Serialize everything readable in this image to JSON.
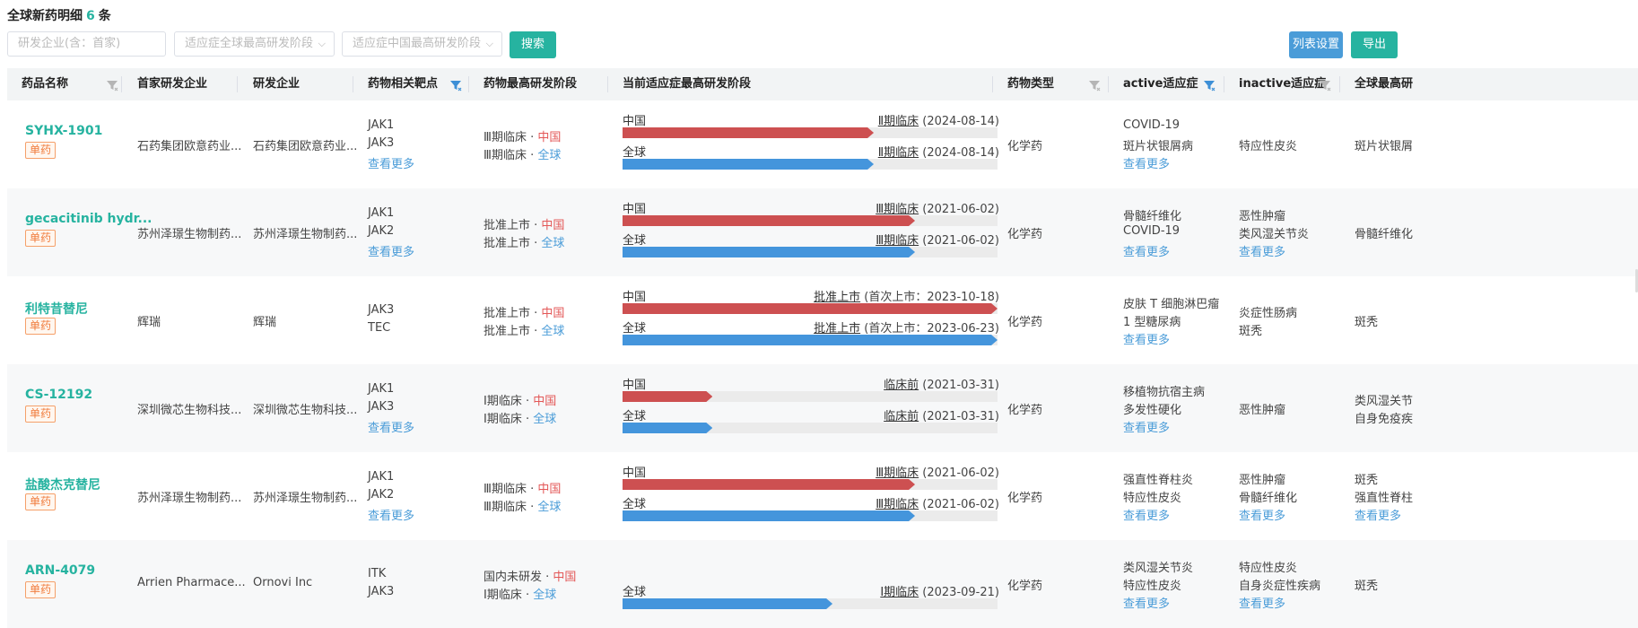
{
  "header": {
    "title_prefix": "全球新药明细",
    "count": "6",
    "title_suffix": "条"
  },
  "filters": {
    "company_placeholder": "研发企业(含：首家)",
    "global_stage_placeholder": "适应症全球最高研发阶段",
    "china_stage_placeholder": "适应症中国最高研发阶段"
  },
  "buttons": {
    "search": "搜索",
    "list_settings": "列表设置",
    "export": "导出"
  },
  "columns": [
    "药品名称",
    "首家研发企业",
    "研发企业",
    "药物相关靶点",
    "药物最高研发阶段",
    "当前适应症最高研发阶段",
    "药物类型",
    "active适应症",
    "inactive适应症",
    "全球最高研"
  ],
  "labels": {
    "more": "查看更多",
    "china": "中国",
    "global": "全球",
    "dot": " · "
  },
  "rows": [
    {
      "name": "SYHX-1901",
      "tag": "单药",
      "first_company": "石药集团欧意药业...",
      "company": "石药集团欧意药业...",
      "targets": [
        "JAK1",
        "JAK3"
      ],
      "targets_more": true,
      "stage_cn": "Ⅲ期临床",
      "stage_gl": "Ⅲ期临床",
      "bars": [
        {
          "region": "中国",
          "color": "red",
          "progress": 0.67,
          "stage": "Ⅱ期临床",
          "note": "(2024-08-14)"
        },
        {
          "region": "全球",
          "color": "blue",
          "progress": 0.67,
          "stage": "Ⅱ期临床",
          "note": "(2024-08-14)"
        }
      ],
      "type": "化学药",
      "active": [
        "COVID-19",
        "斑片状银屑病"
      ],
      "active_more": true,
      "inactive": [
        "特应性皮炎"
      ],
      "inactive_more": false,
      "global_max": [
        "斑片状银屑"
      ],
      "global_more": false
    },
    {
      "name": "gecacitinib hydr...",
      "tag": "单药",
      "first_company": "苏州泽璟生物制药...",
      "company": "苏州泽璟生物制药...",
      "targets": [
        "JAK1",
        "JAK2"
      ],
      "targets_more": true,
      "stage_cn": "批准上市",
      "stage_gl": "批准上市",
      "bars": [
        {
          "region": "中国",
          "color": "red",
          "progress": 0.78,
          "stage": "Ⅲ期临床",
          "note": "(2021-06-02)"
        },
        {
          "region": "全球",
          "color": "blue",
          "progress": 0.78,
          "stage": "Ⅲ期临床",
          "note": "(2021-06-02)"
        }
      ],
      "type": "化学药",
      "active": [
        "骨髓纤维化",
        "COVID-19"
      ],
      "active_more": true,
      "inactive": [
        "恶性肿瘤",
        "类风湿关节炎"
      ],
      "inactive_more": true,
      "global_max": [
        "骨髓纤维化"
      ],
      "global_more": false
    },
    {
      "name": "利特昔替尼",
      "tag": "单药",
      "first_company": "辉瑞",
      "company": "辉瑞",
      "targets": [
        "JAK3",
        "TEC"
      ],
      "targets_more": false,
      "stage_cn": "批准上市",
      "stage_gl": "批准上市",
      "bars": [
        {
          "region": "中国",
          "color": "red",
          "progress": 1.0,
          "stage": "批准上市",
          "note": "(首次上市：2023-10-18)"
        },
        {
          "region": "全球",
          "color": "blue",
          "progress": 1.0,
          "stage": "批准上市",
          "note": "(首次上市：2023-06-23)"
        }
      ],
      "type": "化学药",
      "active": [
        "皮肤 T 细胞淋巴瘤",
        "1 型糖尿病"
      ],
      "active_more": true,
      "inactive": [
        "炎症性肠病",
        "斑秃"
      ],
      "inactive_more": false,
      "global_max": [
        "斑秃"
      ],
      "global_more": false
    },
    {
      "name": "CS-12192",
      "tag": "单药",
      "first_company": "深圳微芯生物科技...",
      "company": "深圳微芯生物科技...",
      "targets": [
        "JAK1",
        "JAK3"
      ],
      "targets_more": true,
      "stage_cn": "Ⅰ期临床",
      "stage_gl": "Ⅰ期临床",
      "bars": [
        {
          "region": "中国",
          "color": "red",
          "progress": 0.24,
          "stage": "临床前",
          "note": "(2021-03-31)"
        },
        {
          "region": "全球",
          "color": "blue",
          "progress": 0.24,
          "stage": "临床前",
          "note": "(2021-03-31)"
        }
      ],
      "type": "化学药",
      "active": [
        "移植物抗宿主病",
        "多发性硬化"
      ],
      "active_more": true,
      "inactive": [
        "恶性肿瘤"
      ],
      "inactive_more": false,
      "global_max": [
        "类风湿关节",
        "自身免疫疾"
      ],
      "global_more": false
    },
    {
      "name": "盐酸杰克替尼",
      "tag": "单药",
      "first_company": "苏州泽璟生物制药...",
      "company": "苏州泽璟生物制药...",
      "targets": [
        "JAK1",
        "JAK2"
      ],
      "targets_more": true,
      "stage_cn": "Ⅲ期临床",
      "stage_gl": "Ⅲ期临床",
      "bars": [
        {
          "region": "中国",
          "color": "red",
          "progress": 0.78,
          "stage": "Ⅲ期临床",
          "note": "(2021-06-02)"
        },
        {
          "region": "全球",
          "color": "blue",
          "progress": 0.78,
          "stage": "Ⅲ期临床",
          "note": "(2021-06-02)"
        }
      ],
      "type": "化学药",
      "active": [
        "强直性脊柱炎",
        "特应性皮炎"
      ],
      "active_more": true,
      "inactive": [
        "恶性肿瘤",
        "骨髓纤维化"
      ],
      "inactive_more": true,
      "global_max": [
        "斑秃",
        "强直性脊柱"
      ],
      "global_more": true
    },
    {
      "name": "ARN-4079",
      "tag": "单药",
      "first_company": "Arrien Pharmace...",
      "company": "Ornovi Inc",
      "targets": [
        "ITK",
        "JAK3"
      ],
      "targets_more": false,
      "stage_cn": "国内未研发",
      "stage_gl": "Ⅰ期临床",
      "bars": [
        {
          "region": "全球",
          "color": "blue",
          "progress": 0.56,
          "stage": "Ⅰ期临床",
          "note": "(2023-09-21)"
        }
      ],
      "type": "化学药",
      "active": [
        "类风湿关节炎",
        "特应性皮炎"
      ],
      "active_more": true,
      "inactive": [
        "特应性皮炎",
        "自身炎症性疾病"
      ],
      "inactive_more": true,
      "global_max": [
        "斑秃"
      ],
      "global_more": false
    }
  ]
}
